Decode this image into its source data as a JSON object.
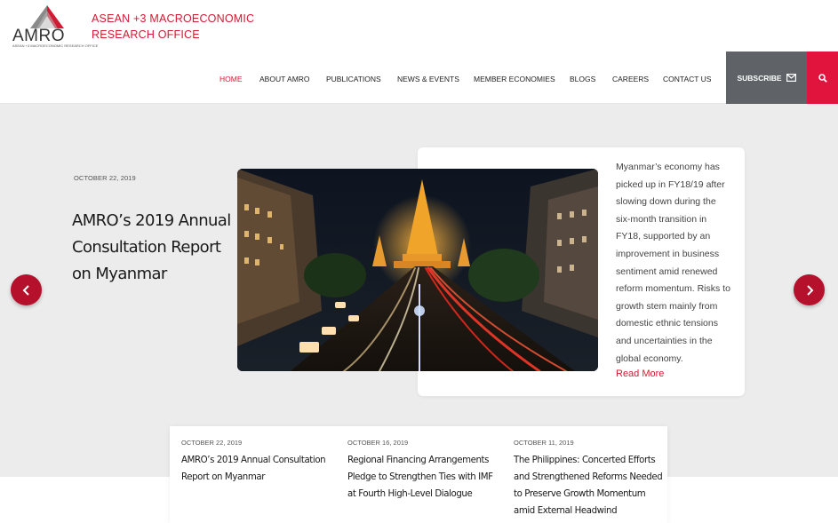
{
  "org": {
    "logo_text": "AMRO",
    "logo_subtext": "ASEAN +3 MACROECONOMIC RESEARCH OFFICE",
    "name_line1": "ASEAN +3 MACROECONOMIC",
    "name_line2": "RESEARCH OFFICE"
  },
  "nav": {
    "items": [
      {
        "label": "HOME",
        "active": true
      },
      {
        "label": "ABOUT AMRO"
      },
      {
        "label": "PUBLICATIONS"
      },
      {
        "label": "NEWS & EVENTS"
      },
      {
        "label": "MEMBER ECONOMIES"
      },
      {
        "label": "BLOGS"
      },
      {
        "label": "CAREERS"
      },
      {
        "label": "CONTACT US"
      }
    ],
    "subscribe_label": "SUBSCRIBE",
    "subscribe_icon": "envelope-icon",
    "search_icon": "search-icon"
  },
  "colors": {
    "brand_red": "#d11a33",
    "search_red": "#e1143d",
    "arrow_red": "#b5112c",
    "subscribe_gray": "#5f6368",
    "hero_bg": "#ececec"
  },
  "hero": {
    "date": "OCTOBER 22, 2019",
    "title_lines": [
      "AMRO’s 2019 Annual",
      "Consultation Report",
      "on Myanmar"
    ],
    "summary_lines": [
      "Myanmar’s economy has",
      "picked up in  FY18/19 after",
      "slowing down during the",
      "six-month transition in",
      "FY18, supported by an",
      "improvement in business",
      "sentiment amid renewed",
      "reform momentum.  Risks to",
      "growth stem mainly from",
      "domestic ethnic tensions",
      "and uncertainties in the",
      "global economy."
    ],
    "read_more": "Read  More",
    "prev_icon": "chevron-left-icon",
    "next_icon": "chevron-right-icon"
  },
  "news": [
    {
      "date": "OCTOBER 22, 2019",
      "title_lines": [
        "AMRO’s 2019 Annual Consultation",
        "Report on Myanmar"
      ]
    },
    {
      "date": "OCTOBER 16, 2019",
      "title_lines": [
        "Regional Financing Arrangements",
        "Pledge to Strengthen Ties with IMF",
        "at Fourth High-Level Dialogue"
      ]
    },
    {
      "date": "OCTOBER 11, 2019",
      "title_lines": [
        "The Philippines: Concerted Efforts",
        "and Strengthened Reforms Needed",
        "to Preserve Growth Momentum",
        "amid External Headwind"
      ]
    }
  ]
}
